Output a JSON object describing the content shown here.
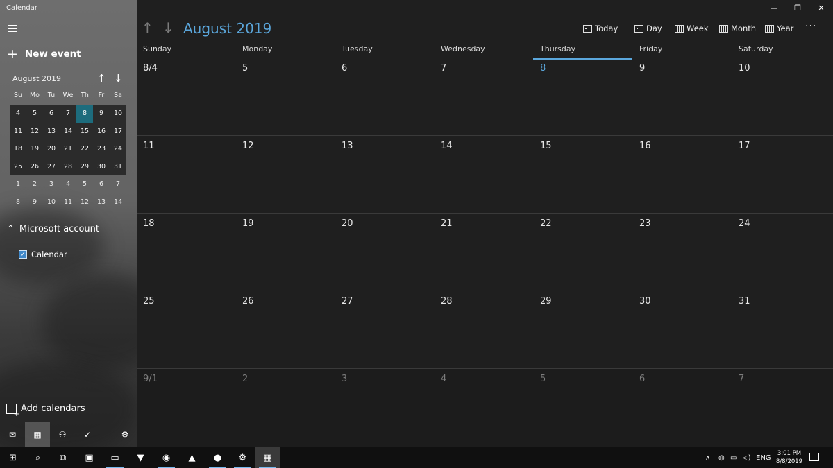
{
  "app": {
    "title": "Calendar"
  },
  "sidebar": {
    "new_event_label": "New event",
    "mini_calendar": {
      "title": "August 2019",
      "weekdays": [
        "Su",
        "Mo",
        "Tu",
        "We",
        "Th",
        "Fr",
        "Sa"
      ],
      "weeks": [
        [
          "4",
          "5",
          "6",
          "7",
          "8",
          "9",
          "10"
        ],
        [
          "11",
          "12",
          "13",
          "14",
          "15",
          "16",
          "17"
        ],
        [
          "18",
          "19",
          "20",
          "21",
          "22",
          "23",
          "24"
        ],
        [
          "25",
          "26",
          "27",
          "28",
          "29",
          "30",
          "31"
        ],
        [
          "1",
          "2",
          "3",
          "4",
          "5",
          "6",
          "7"
        ],
        [
          "8",
          "9",
          "10",
          "11",
          "12",
          "13",
          "14"
        ]
      ],
      "selected_day": "8"
    },
    "account_label": "Microsoft account",
    "calendar_item_label": "Calendar",
    "add_calendars_label": "Add calendars",
    "bottom_icons": [
      "mail-icon",
      "calendar-icon",
      "people-icon",
      "todo-icon",
      "settings-icon"
    ]
  },
  "header": {
    "month_title": "August 2019",
    "toolbar": {
      "today": "Today",
      "day": "Day",
      "week": "Week",
      "month": "Month",
      "year": "Year",
      "more": "···"
    }
  },
  "weekdays": [
    "Sunday",
    "Monday",
    "Tuesday",
    "Wednesday",
    "Thursday",
    "Friday",
    "Saturday"
  ],
  "weeks": [
    [
      "8/4",
      "5",
      "6",
      "7",
      "8",
      "9",
      "10"
    ],
    [
      "11",
      "12",
      "13",
      "14",
      "15",
      "16",
      "17"
    ],
    [
      "18",
      "19",
      "20",
      "21",
      "22",
      "23",
      "24"
    ],
    [
      "25",
      "26",
      "27",
      "28",
      "29",
      "30",
      "31"
    ],
    [
      "9/1",
      "2",
      "3",
      "4",
      "5",
      "6",
      "7"
    ]
  ],
  "today": {
    "week": 0,
    "day": 4
  },
  "colors": {
    "accent": "#5ba7dc",
    "selected": "#1d6c7d"
  },
  "taskbar": {
    "apps": [
      "windows-start-icon",
      "search-icon",
      "task-view-icon",
      "tools-icon",
      "file-explorer-icon",
      "brave-browser-icon",
      "browser-icon",
      "photos-icon",
      "spotify-icon",
      "settings-icon",
      "calendar-app-icon"
    ],
    "language": "ENG",
    "time": "3:01 PM",
    "date": "8/8/2019"
  }
}
